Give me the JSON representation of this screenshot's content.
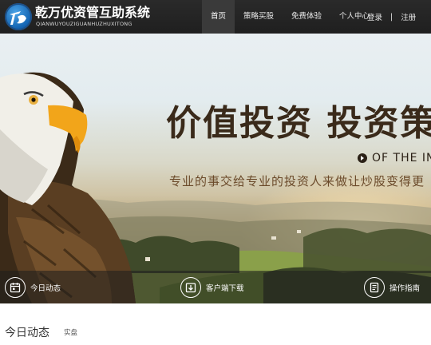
{
  "logo": {
    "name_cn": "乾万优资管互助系统",
    "name_pinyin": "QIANWUYOUZIGUANHUZHUXITONG"
  },
  "nav": {
    "items": [
      {
        "label": "首页",
        "active": true
      },
      {
        "label": "策略买股",
        "active": false
      },
      {
        "label": "免费体验",
        "active": false
      },
      {
        "label": "个人中心",
        "active": false
      }
    ],
    "login": "登录",
    "separator": "|",
    "register": "注册"
  },
  "banner": {
    "headline": "价值投资 投资策",
    "subtitle_en": "OF THE INV",
    "tagline": "专业的事交给专业的投资人来做让炒股变得更"
  },
  "actions": [
    {
      "label": "今日动态",
      "icon": "calendar-icon"
    },
    {
      "label": "客户端下载",
      "icon": "download-icon"
    },
    {
      "label": "操作指南",
      "icon": "guide-book-icon"
    }
  ],
  "section": {
    "title": "今日动态",
    "tag": "实盘"
  },
  "colors": {
    "nav_bg": "#222222",
    "nav_active_bg": "#3a3a3a",
    "headline": "#3a2a1a",
    "tagline": "#6b4a2a"
  }
}
